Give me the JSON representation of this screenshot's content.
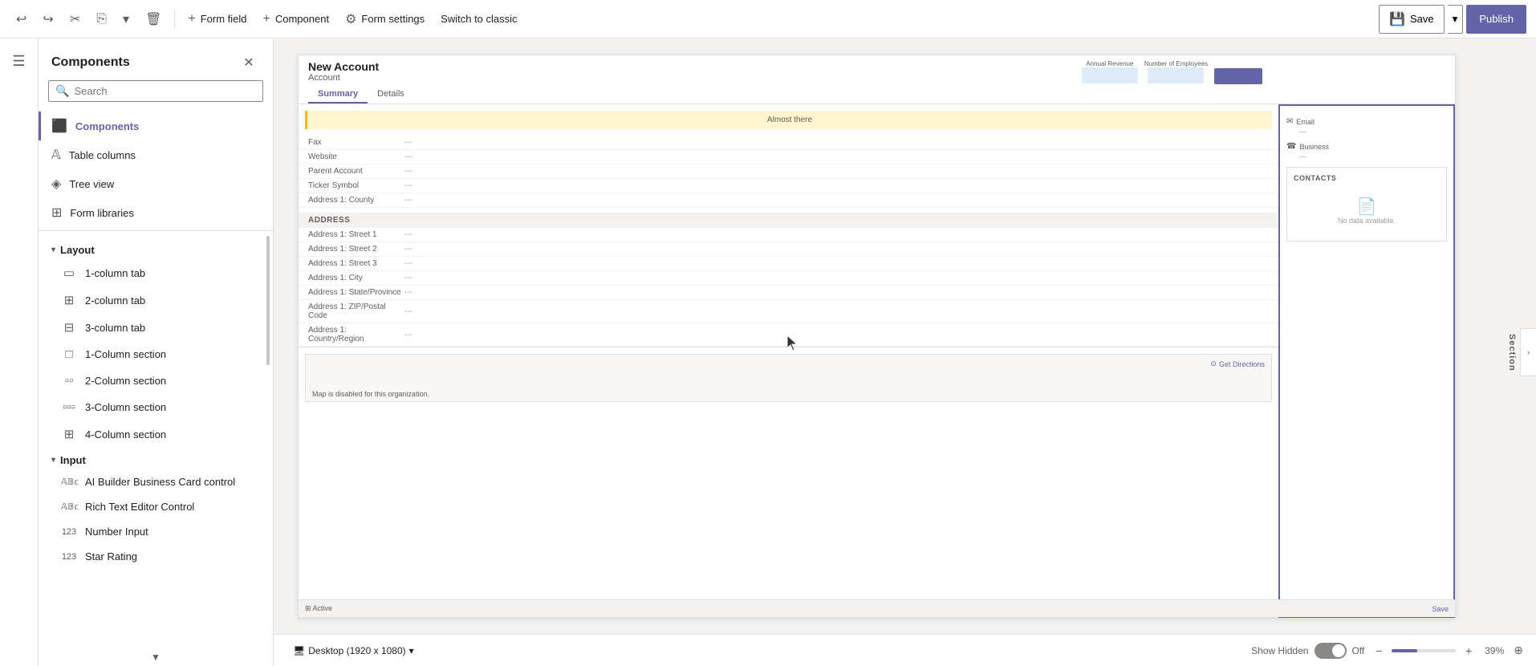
{
  "toolbar": {
    "undo_label": "Undo",
    "redo_label": "Redo",
    "cut_label": "Cut",
    "copy_label": "Copy",
    "delete_label": "Delete",
    "form_field_label": "Form field",
    "component_label": "Component",
    "form_settings_label": "Form settings",
    "switch_classic_label": "Switch to classic",
    "save_label": "Save",
    "publish_label": "Publish"
  },
  "nav": {
    "hamburger_label": "Menu"
  },
  "panel": {
    "title": "Components",
    "search_placeholder": "Search",
    "nav_items": [
      {
        "id": "components",
        "label": "Components"
      },
      {
        "id": "table-columns",
        "label": "Table columns"
      },
      {
        "id": "tree-view",
        "label": "Tree view"
      },
      {
        "id": "form-libraries",
        "label": "Form libraries"
      }
    ],
    "layout_section": {
      "label": "Layout",
      "items": [
        {
          "id": "1-column-tab",
          "label": "1-column tab"
        },
        {
          "id": "2-column-tab",
          "label": "2-column tab"
        },
        {
          "id": "3-column-tab",
          "label": "3-column tab"
        },
        {
          "id": "1-column-section",
          "label": "1-Column section"
        },
        {
          "id": "2-column-section",
          "label": "2-Column section"
        },
        {
          "id": "3-column-section",
          "label": "3-Column section"
        },
        {
          "id": "4-column-section",
          "label": "4-Column section"
        }
      ]
    },
    "input_section": {
      "label": "Input",
      "items": [
        {
          "id": "ai-builder",
          "label": "AI Builder Business Card control"
        },
        {
          "id": "rich-text",
          "label": "Rich Text Editor Control"
        },
        {
          "id": "number-input",
          "label": "Number Input"
        },
        {
          "id": "star-rating",
          "label": "Star Rating"
        }
      ]
    }
  },
  "form": {
    "title": "New Account",
    "subtitle": "Account",
    "tabs": [
      {
        "id": "summary",
        "label": "Summary",
        "active": true
      },
      {
        "id": "details",
        "label": "Details"
      }
    ],
    "alert_text": "Almost there",
    "fields": [
      {
        "label": "Fax",
        "value": "---"
      },
      {
        "label": "Website",
        "value": "---"
      },
      {
        "label": "Parent Account",
        "value": "---"
      },
      {
        "label": "Ticker Symbol",
        "value": "---"
      },
      {
        "label": "Address 1: County",
        "value": "---"
      }
    ],
    "address_section": {
      "title": "ADDRESS",
      "fields": [
        {
          "label": "Address 1: Street 1",
          "value": "---"
        },
        {
          "label": "Address 1: Street 2",
          "value": "---"
        },
        {
          "label": "Address 1: Street 3",
          "value": "---"
        },
        {
          "label": "Address 1: City",
          "value": "---"
        },
        {
          "label": "Address 1: State/Province",
          "value": "---"
        },
        {
          "label": "Address 1: ZIP/Postal Code",
          "value": "---"
        },
        {
          "label": "Address 1: Country/Region",
          "value": "---"
        }
      ]
    },
    "map": {
      "disabled_text": "Map is disabled for this organization.",
      "directions_text": "Get Directions"
    },
    "side_panel": {
      "chart_labels": [
        "Annual Revenue",
        "Number of Employees"
      ],
      "email_label": "Email",
      "email_value": "---",
      "business_label": "Business",
      "business_value": "---",
      "contacts_title": "CONTACTS",
      "contacts_empty": "No data available."
    }
  },
  "bottom_bar": {
    "desktop_label": "Desktop (1920 x 1080)",
    "show_hidden_label": "Show Hidden",
    "toggle_state": "Off",
    "zoom_level": "39%"
  },
  "section_label": "Section"
}
